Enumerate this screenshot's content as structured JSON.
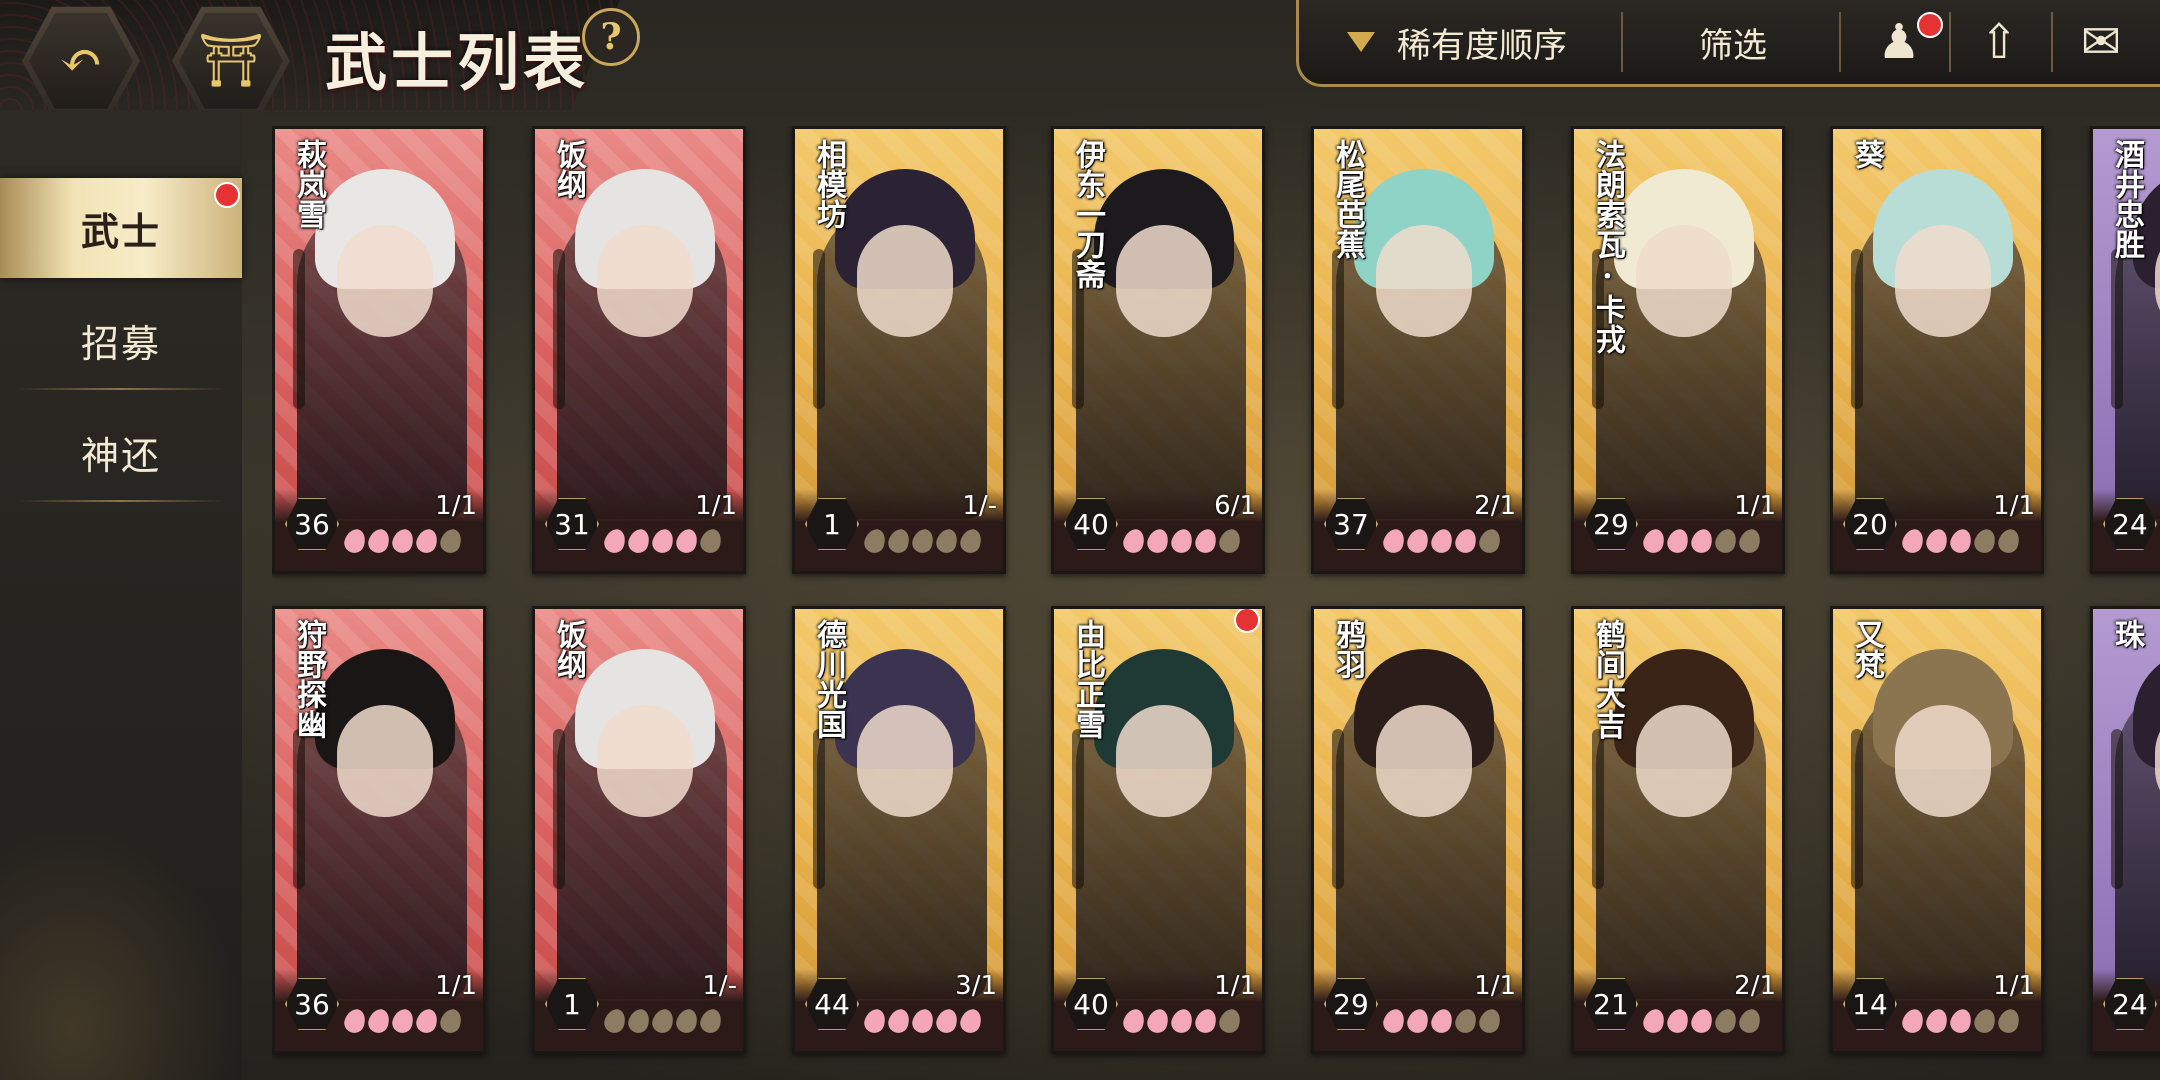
{
  "header": {
    "title": "武士列表",
    "help": "?",
    "sort_label": "稀有度顺序",
    "filter_label": "筛选"
  },
  "colors": {
    "accent_gold": "#d4ab4c",
    "notification": "#e53232"
  },
  "sidebar": {
    "items": [
      {
        "label": "武士",
        "active": true,
        "notification": true
      },
      {
        "label": "招募",
        "active": false
      },
      {
        "label": "神还",
        "active": false
      }
    ]
  },
  "cards": [
    {
      "name": "萩岚雪",
      "level": "36",
      "count": "1/1",
      "rarity": 4,
      "frame": "red"
    },
    {
      "name": "饭纲",
      "level": "31",
      "count": "1/1",
      "rarity": 4,
      "frame": "red"
    },
    {
      "name": "相模坊",
      "level": "1",
      "count": "1/-",
      "rarity": 0,
      "frame": "gold"
    },
    {
      "name": "伊东一刀斋",
      "level": "40",
      "count": "6/1",
      "rarity": 4,
      "frame": "gold"
    },
    {
      "name": "松尾芭蕉",
      "level": "37",
      "count": "2/1",
      "rarity": 4,
      "frame": "gold"
    },
    {
      "name": "法朗索瓦·卡戎",
      "level": "29",
      "count": "1/1",
      "rarity": 3,
      "frame": "gold"
    },
    {
      "name": "葵",
      "level": "20",
      "count": "1/1",
      "rarity": 3,
      "frame": "gold"
    },
    {
      "name": "酒井忠胜",
      "level": "24",
      "count": "",
      "rarity": 0,
      "frame": "purple"
    },
    {
      "name": "狩野探幽",
      "level": "36",
      "count": "1/1",
      "rarity": 4,
      "frame": "red"
    },
    {
      "name": "饭纲",
      "level": "1",
      "count": "1/-",
      "rarity": 0,
      "frame": "red"
    },
    {
      "name": "德川光国",
      "level": "44",
      "count": "3/1",
      "rarity": 5,
      "frame": "gold"
    },
    {
      "name": "由比正雪",
      "level": "40",
      "count": "1/1",
      "rarity": 4,
      "frame": "gold",
      "notification": true
    },
    {
      "name": "鸦羽",
      "level": "29",
      "count": "1/1",
      "rarity": 3,
      "frame": "gold"
    },
    {
      "name": "鹤间大吉",
      "level": "21",
      "count": "2/1",
      "rarity": 3,
      "frame": "gold"
    },
    {
      "name": "又梵",
      "level": "14",
      "count": "1/1",
      "rarity": 3,
      "frame": "gold"
    },
    {
      "name": "珠",
      "level": "24",
      "count": "",
      "rarity": 0,
      "frame": "purple"
    }
  ]
}
